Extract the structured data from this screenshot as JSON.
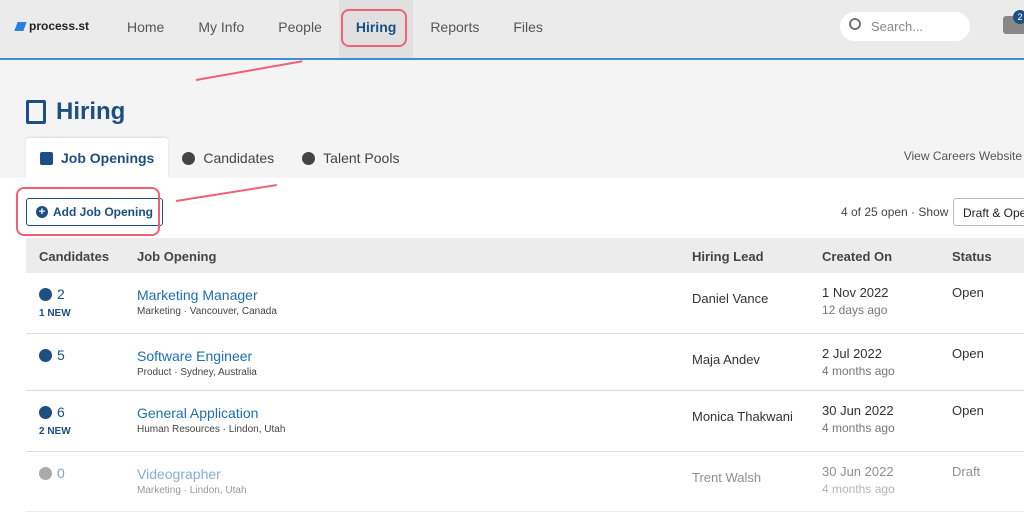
{
  "app": {
    "logo": "process.st"
  },
  "nav": [
    "Home",
    "My Info",
    "People",
    "Hiring",
    "Reports",
    "Files"
  ],
  "search": {
    "placeholder": "Search..."
  },
  "inbox_badge": "2",
  "page_title": "Hiring",
  "tabs": [
    "Job Openings",
    "Candidates",
    "Talent Pools"
  ],
  "careers_link": "View Careers Website",
  "add_button": "Add Job Opening",
  "open_count": "4 of 25 open · Show",
  "filter": "Draft & Open",
  "columns": [
    "Candidates",
    "Job Opening",
    "Hiring Lead",
    "Created On",
    "Status"
  ],
  "rows": [
    {
      "count": "2",
      "new": "1 NEW",
      "title": "Marketing Manager",
      "sub": "Marketing · Vancouver, Canada",
      "lead": "Daniel Vance",
      "date": "1 Nov 2022",
      "ago": "12 days ago",
      "status": "Open"
    },
    {
      "count": "5",
      "new": "",
      "title": "Software Engineer",
      "sub": "Product · Sydney, Australia",
      "lead": "Maja Andev",
      "date": "2 Jul 2022",
      "ago": "4 months ago",
      "status": "Open"
    },
    {
      "count": "6",
      "new": "2 NEW",
      "title": "General Application",
      "sub": "Human Resources · Lindon, Utah",
      "lead": "Monica Thakwani",
      "date": "30 Jun 2022",
      "ago": "4 months ago",
      "status": "Open"
    },
    {
      "count": "0",
      "new": "",
      "title": "Videographer",
      "sub": "Marketing · Lindon, Utah",
      "lead": "Trent Walsh",
      "date": "30 Jun 2022",
      "ago": "4 months ago",
      "status": "Draft"
    }
  ]
}
